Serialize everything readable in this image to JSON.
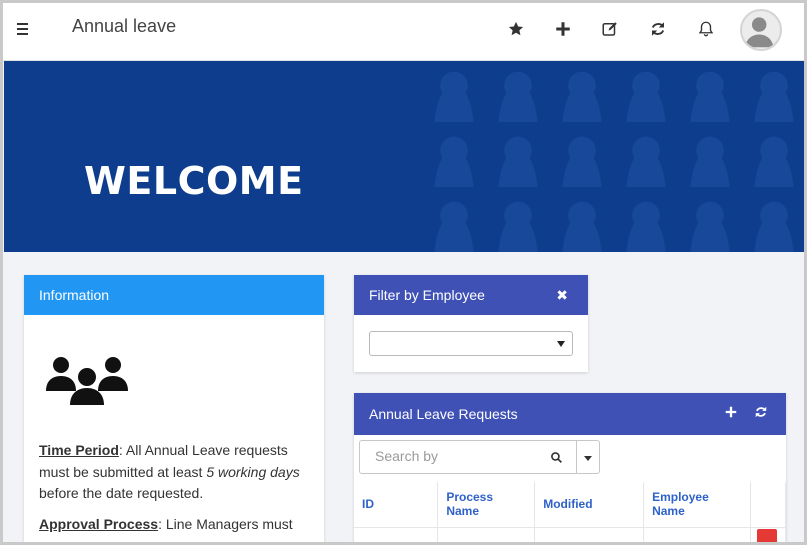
{
  "header": {
    "title": "Annual leave",
    "icons": [
      "menu-icon",
      "star-icon",
      "plus-icon",
      "edit-icon",
      "refresh-icon",
      "bell-icon",
      "avatar"
    ]
  },
  "hero": {
    "heading": "WELCOME",
    "background_color": "#0d3d8c"
  },
  "info_panel": {
    "title": "Information",
    "header_color": "#2196f3",
    "icon": "people-group-icon",
    "paragraphs": [
      {
        "term": "Time Period",
        "text_before": ": All Annual Leave requests must be submitted at least ",
        "emphasis": "5 working days",
        "text_after": " before the date requested."
      },
      {
        "term": "Approval Process",
        "text": ": Line Managers must"
      }
    ]
  },
  "filter_panel": {
    "title": "Filter by Employee",
    "header_color": "#3f51b5",
    "selected_value": ""
  },
  "requests_panel": {
    "title": "Annual Leave Requests",
    "header_color": "#3f51b5",
    "search_placeholder": "Search by",
    "columns": [
      "ID",
      "Process Name",
      "Modified",
      "Employee Name",
      ""
    ]
  }
}
